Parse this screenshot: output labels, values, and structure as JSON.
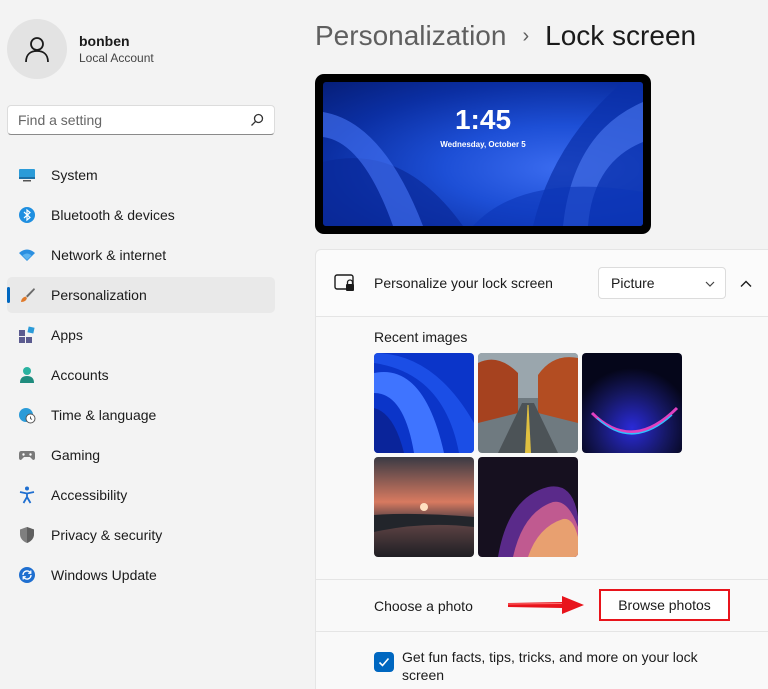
{
  "user": {
    "name": "bonben",
    "account_type": "Local Account"
  },
  "search": {
    "placeholder": "Find a setting"
  },
  "nav": {
    "items": [
      {
        "label": "System",
        "icon": "system-icon"
      },
      {
        "label": "Bluetooth & devices",
        "icon": "bluetooth-icon"
      },
      {
        "label": "Network & internet",
        "icon": "wifi-icon"
      },
      {
        "label": "Personalization",
        "icon": "brush-icon",
        "active": true
      },
      {
        "label": "Apps",
        "icon": "apps-icon"
      },
      {
        "label": "Accounts",
        "icon": "person-icon"
      },
      {
        "label": "Time & language",
        "icon": "globe-clock-icon"
      },
      {
        "label": "Gaming",
        "icon": "gamepad-icon"
      },
      {
        "label": "Accessibility",
        "icon": "accessibility-icon"
      },
      {
        "label": "Privacy & security",
        "icon": "shield-icon"
      },
      {
        "label": "Windows Update",
        "icon": "update-icon"
      }
    ]
  },
  "breadcrumb": {
    "parent": "Personalization",
    "separator": "›",
    "current": "Lock screen"
  },
  "preview": {
    "time": "1:45",
    "date": "Wednesday, October 5"
  },
  "personalize": {
    "label": "Personalize your lock screen",
    "selected": "Picture"
  },
  "recent_images": {
    "label": "Recent images",
    "items": [
      "blue-bloom-thumbnail",
      "autumn-road-thumbnail",
      "purple-glow-thumbnail",
      "sunset-lake-thumbnail",
      "purple-ribbon-thumbnail"
    ]
  },
  "choose_photo": {
    "label": "Choose a photo",
    "button": "Browse photos"
  },
  "fun_facts": {
    "label": "Get fun facts, tips, tricks, and more on your lock screen",
    "checked": true
  },
  "colors": {
    "accent": "#0067c0",
    "highlight": "#e8141c"
  }
}
